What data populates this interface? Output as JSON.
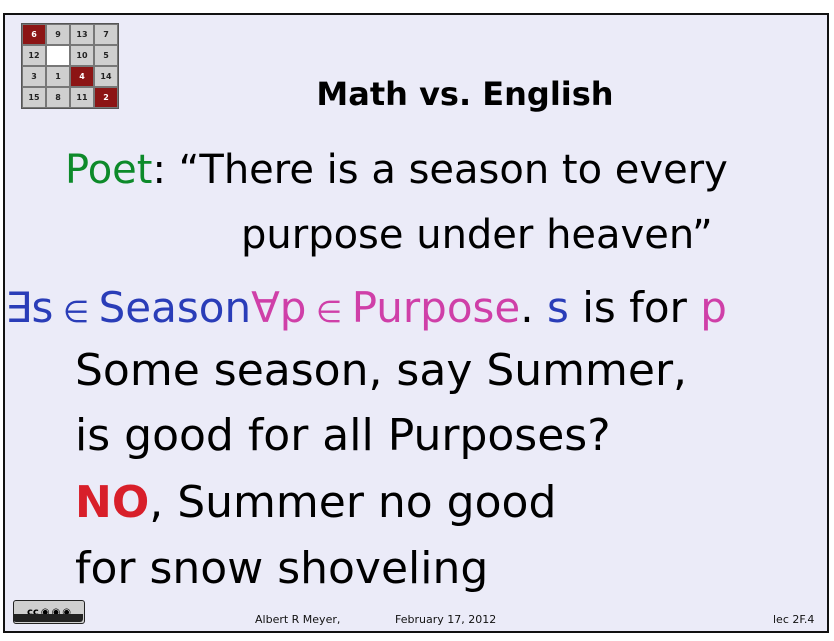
{
  "puzzle": {
    "tiles": [
      {
        "label": "6",
        "color": "red"
      },
      {
        "label": "9",
        "color": "gray"
      },
      {
        "label": "13",
        "color": "gray"
      },
      {
        "label": "7",
        "color": "gray"
      },
      {
        "label": "12",
        "color": "gray"
      },
      {
        "label": "",
        "color": "empty"
      },
      {
        "label": "10",
        "color": "gray"
      },
      {
        "label": "5",
        "color": "gray"
      },
      {
        "label": "3",
        "color": "gray"
      },
      {
        "label": "1",
        "color": "gray"
      },
      {
        "label": "4",
        "color": "red"
      },
      {
        "label": "14",
        "color": "gray"
      },
      {
        "label": "15",
        "color": "gray"
      },
      {
        "label": "8",
        "color": "gray"
      },
      {
        "label": "11",
        "color": "gray"
      },
      {
        "label": "2",
        "color": "red"
      }
    ]
  },
  "slide": {
    "title": "Math vs. English",
    "poet_label": "Poet",
    "poet_colon": ":",
    "quote_line1": " “There is a season to every",
    "quote_line2": "purpose under heaven”",
    "logic": {
      "exists": "∃s",
      "in1": " ∈ ",
      "season": "Season",
      "forall": "∀p",
      "in2": " ∈ ",
      "purpose": "Purpose",
      "dot": ". ",
      "s": "s",
      "is_for": " is for ",
      "p": "p"
    },
    "line1": "Some season, say Summer,",
    "line2": "is good for all Purposes?",
    "no": "NO",
    "line3_rest": ", Summer no good",
    "line4": "for snow shoveling"
  },
  "footer": {
    "author": "Albert R Meyer,",
    "date": "February 17, 2012",
    "lecture": "lec 2F.4",
    "license_badge": "cc"
  },
  "colors": {
    "green": "#0d8a2a",
    "blue": "#2a3db8",
    "pink": "#cf3fa8",
    "red": "#d81f2a",
    "background": "#ebebf8"
  }
}
